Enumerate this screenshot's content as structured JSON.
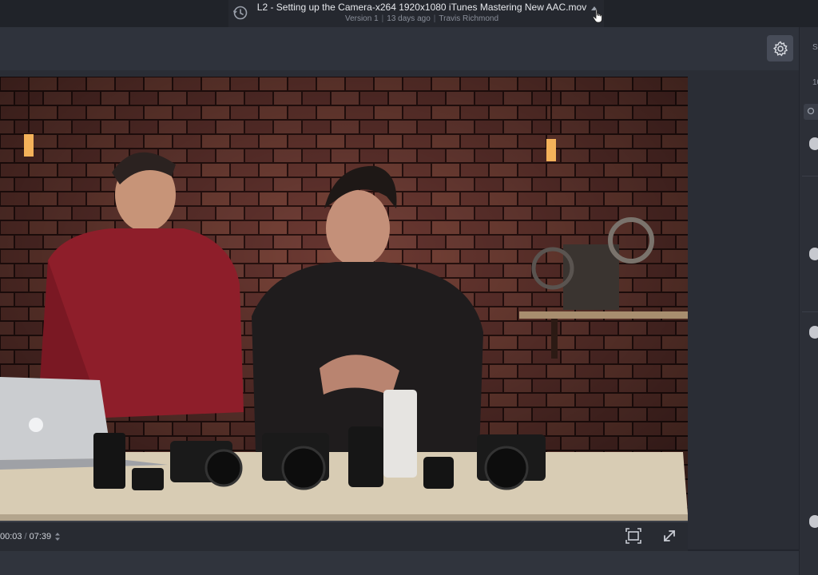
{
  "header": {
    "file_title": "L2 - Setting up the Camera-x264 1920x1080 iTunes Mastering New AAC.mov",
    "version": "Version 1",
    "age": "13 days ago",
    "author": "Travis Richmond"
  },
  "player": {
    "current_time": "00:03",
    "separator": "/",
    "duration": "07:39"
  },
  "right_panel": {
    "heading_fragment": "S",
    "count_fragment": "10"
  },
  "icons": {
    "history": "history-icon",
    "settings": "gear-icon",
    "fit": "fit-screen-icon",
    "fullscreen": "expand-icon",
    "search": "search-icon"
  }
}
